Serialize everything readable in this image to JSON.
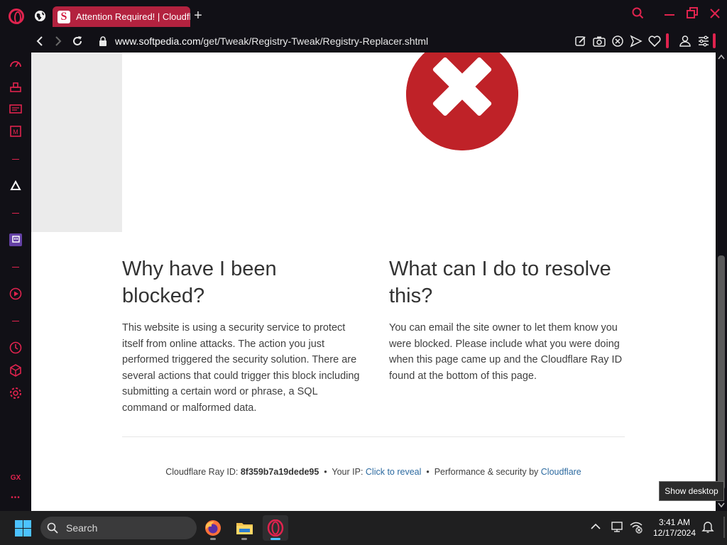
{
  "browser": {
    "tab": {
      "title": "Attention Required! | Cloudflare",
      "favicon_letter": "S"
    },
    "address": {
      "host": "www.softpedia.com",
      "path": "/get/Tweak/Registry-Tweak/Registry-Replacer.shtml"
    },
    "accent_color": "#e0234e"
  },
  "page": {
    "left": {
      "heading": "Why have I been blocked?",
      "body": "This website is using a security service to protect itself from online attacks. The action you just performed triggered the security solution. There are several actions that could trigger this block including submitting a certain word or phrase, a SQL command or malformed data."
    },
    "right": {
      "heading": "What can I do to resolve this?",
      "body": "You can email the site owner to let them know you were blocked. Please include what you were doing when this page came up and the Cloudflare Ray ID found at the bottom of this page."
    },
    "footer": {
      "ray_label": "Cloudflare Ray ID:",
      "ray_id": "8f359b7a19dede95",
      "sep1": "•",
      "ip_label": "Your IP:",
      "ip_link": "Click to reveal",
      "sep2": "•",
      "perf_label": "Performance & security by",
      "perf_link": "Cloudflare"
    },
    "error_color": "#bf2228"
  },
  "sidebar": {
    "gx_label": "GX",
    "more_label": "•••"
  },
  "tooltip": {
    "text": "Show desktop"
  },
  "taskbar": {
    "search_placeholder": "Search",
    "clock": {
      "time": "3:41 AM",
      "date": "12/17/2024"
    }
  }
}
